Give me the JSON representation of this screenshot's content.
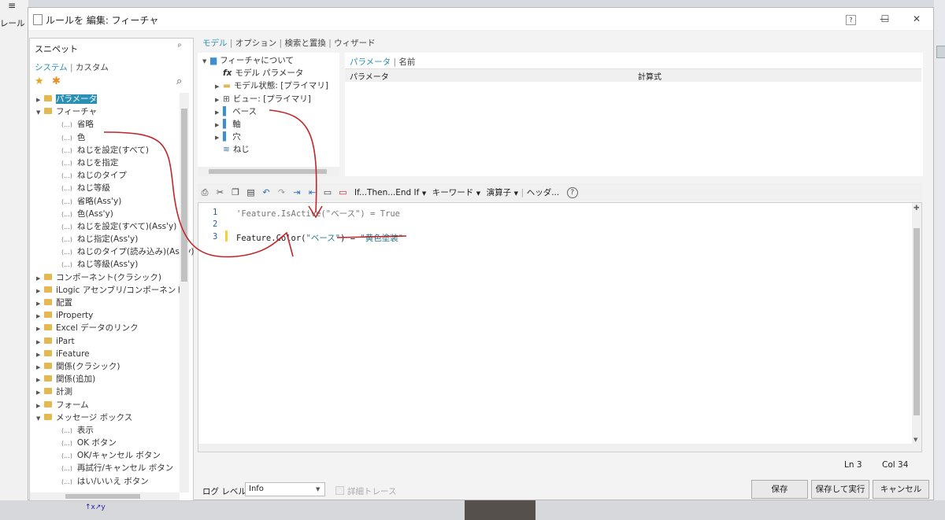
{
  "outer": {
    "left_label": "レール"
  },
  "window": {
    "title": "ルールを 編集: フィーチャ",
    "controls": {
      "help": "?",
      "minimize": "—",
      "maximize": "☐",
      "close": "✕"
    }
  },
  "snippets": {
    "title": "スニペット",
    "pin": "ᵖ",
    "tab_system": "システム",
    "tab_custom": "カスタム",
    "tree": [
      {
        "type": "folder",
        "label": "パラメータ",
        "expanded": false,
        "selected": true
      },
      {
        "type": "folder",
        "label": "フィーチャ",
        "expanded": true
      },
      {
        "type": "leaf",
        "label": "省略"
      },
      {
        "type": "leaf",
        "label": "色"
      },
      {
        "type": "leaf",
        "label": "ねじを設定(すべて)"
      },
      {
        "type": "leaf",
        "label": "ねじを指定"
      },
      {
        "type": "leaf",
        "label": "ねじのタイプ"
      },
      {
        "type": "leaf",
        "label": "ねじ等級"
      },
      {
        "type": "leaf",
        "label": "省略(Ass'y)"
      },
      {
        "type": "leaf",
        "label": "色(Ass'y)"
      },
      {
        "type": "leaf",
        "label": "ねじを設定(すべて)(Ass'y)"
      },
      {
        "type": "leaf",
        "label": "ねじ指定(Ass'y)"
      },
      {
        "type": "leaf",
        "label": "ねじのタイプ(読み込み)(Ass'y)"
      },
      {
        "type": "leaf",
        "label": "ねじ等級(Ass'y)"
      },
      {
        "type": "folder",
        "label": "コンポーネント(クラシック)",
        "expanded": false
      },
      {
        "type": "folder",
        "label": "iLogic アセンブリ/コンポーネント",
        "expanded": false
      },
      {
        "type": "folder",
        "label": "配置",
        "expanded": false
      },
      {
        "type": "folder",
        "label": "iProperty",
        "expanded": false
      },
      {
        "type": "folder",
        "label": "Excel データのリンク",
        "expanded": false
      },
      {
        "type": "folder",
        "label": "iPart",
        "expanded": false
      },
      {
        "type": "folder",
        "label": "iFeature",
        "expanded": false
      },
      {
        "type": "folder",
        "label": "関係(クラシック)",
        "expanded": false
      },
      {
        "type": "folder",
        "label": "関係(追加)",
        "expanded": false
      },
      {
        "type": "folder",
        "label": "計測",
        "expanded": false
      },
      {
        "type": "folder",
        "label": "フォーム",
        "expanded": false
      },
      {
        "type": "folder",
        "label": "メッセージ ボックス",
        "expanded": true
      },
      {
        "type": "leaf",
        "label": "表示"
      },
      {
        "type": "leaf",
        "label": "OK ボタン"
      },
      {
        "type": "leaf",
        "label": "OK/キャンセル ボタン"
      },
      {
        "type": "leaf",
        "label": "再試行/キャンセル ボタン"
      },
      {
        "type": "leaf",
        "label": "はい/いいえ ボタン"
      }
    ]
  },
  "top_tabs": [
    "モデル",
    "オプション",
    "検索と置換",
    "ウィザード"
  ],
  "model_tree": [
    {
      "label": "フィーチャについて",
      "icon": "part-icon",
      "indent": 0,
      "arrow": "▼"
    },
    {
      "label": "モデル パラメータ",
      "icon": "fx-icon",
      "indent": 1,
      "arrow": ""
    },
    {
      "label": "モデル状態: [プライマリ]",
      "icon": "folder-icon",
      "indent": 1,
      "arrow": "▶"
    },
    {
      "label": "ビュー: [プライマリ]",
      "icon": "view-icon",
      "indent": 1,
      "arrow": "▶"
    },
    {
      "label": "ベース",
      "icon": "feature-icon",
      "indent": 1,
      "arrow": "▶"
    },
    {
      "label": "軸",
      "icon": "feature-icon",
      "indent": 1,
      "arrow": "▶"
    },
    {
      "label": "穴",
      "icon": "feature-icon",
      "indent": 1,
      "arrow": "▶"
    },
    {
      "label": "ねじ",
      "icon": "thread-icon",
      "indent": 1,
      "arrow": ""
    }
  ],
  "param_panel": {
    "tab_param": "パラメータ",
    "tab_name": "名前",
    "col_param": "パラメータ",
    "col_formula": "計算式"
  },
  "toolbar": {
    "ifthen": "If...Then...End If",
    "keyword": "キーワード",
    "operator": "演算子",
    "header": "ヘッダ..."
  },
  "code": {
    "lines": [
      {
        "num": "1",
        "text": "'Feature.IsActive(\"ベース\") = True"
      },
      {
        "num": "2",
        "text": ""
      },
      {
        "num": "3",
        "call": "Feature.Color(",
        "arg": "\"ベース\"",
        "close": ") = ",
        "value": "\"黄色塗装\""
      }
    ]
  },
  "status": {
    "line": "Ln 3",
    "col": "Col 34"
  },
  "footer": {
    "log_label": "ログ レベル",
    "log_value": "Info",
    "trace_label": "詳細トレース",
    "save": "保存",
    "save_run": "保存して実行",
    "cancel": "キャンセル"
  },
  "colors": {
    "accent": "#2a8fb5",
    "annotation": "#c0262b",
    "string": "#1f7a8c",
    "folder": "#e3b851"
  }
}
